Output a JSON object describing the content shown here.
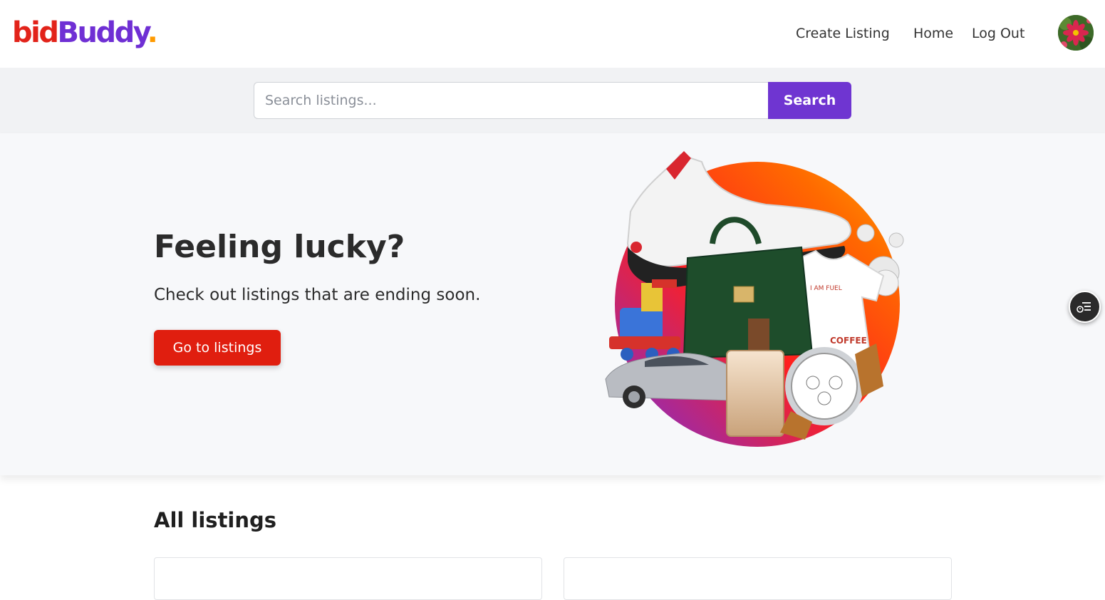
{
  "brand": {
    "part1": "bid",
    "part2": "Buddy",
    "part3": "."
  },
  "nav": {
    "create_listing": "Create Listing",
    "home": "Home",
    "log_out": "Log Out"
  },
  "search": {
    "placeholder": "Search listings...",
    "value": "",
    "button_label": "Search"
  },
  "hero": {
    "title": "Feeling lucky?",
    "subtitle": "Check out listings that are ending soon.",
    "button_label": "Go to listings"
  },
  "listings": {
    "section_title": "All listings"
  },
  "icons": {
    "avatar": "avatar-flower-image",
    "float_widget": "list-clock-icon"
  },
  "colors": {
    "brand_red": "#e2231a",
    "brand_purple": "#6f2fd4",
    "brand_orange": "#ff9a00",
    "search_button": "#6f35d1",
    "hero_button": "#e01e0f"
  }
}
